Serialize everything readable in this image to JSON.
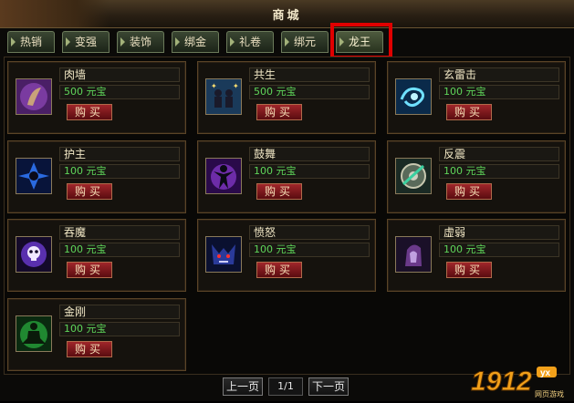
{
  "header": {
    "title": "商城"
  },
  "tabs": [
    {
      "label": "热销"
    },
    {
      "label": "变强"
    },
    {
      "label": "装饰"
    },
    {
      "label": "绑金"
    },
    {
      "label": "礼卷"
    },
    {
      "label": "绑元"
    },
    {
      "label": "龙王",
      "active": true
    }
  ],
  "items": [
    {
      "name": "肉墙",
      "price": "500 元宝",
      "buy": "购买",
      "icon": "tusk-icon",
      "color": "#7a3ba0"
    },
    {
      "name": "共生",
      "price": "500 元宝",
      "buy": "购买",
      "icon": "twin-figures-icon",
      "color": "#2b5a8a"
    },
    {
      "name": "玄雷击",
      "price": "100 元宝",
      "buy": "购买",
      "icon": "lightning-swirl-icon",
      "color": "#1e8ab8"
    },
    {
      "name": "护主",
      "price": "100 元宝",
      "buy": "购买",
      "icon": "shield-burst-icon",
      "color": "#1a4fa0"
    },
    {
      "name": "鼓舞",
      "price": "100 元宝",
      "buy": "购买",
      "icon": "figure-glow-icon",
      "color": "#6a2c9a"
    },
    {
      "name": "反震",
      "price": "100 元宝",
      "buy": "购买",
      "icon": "round-shield-icon",
      "color": "#3a6a4a"
    },
    {
      "name": "吞魔",
      "price": "100 元宝",
      "buy": "购买",
      "icon": "skull-orb-icon",
      "color": "#5a3aa0"
    },
    {
      "name": "愤怒",
      "price": "100 元宝",
      "buy": "购买",
      "icon": "demon-face-icon",
      "color": "#2a3a8a"
    },
    {
      "name": "虚弱",
      "price": "100 元宝",
      "buy": "购买",
      "icon": "ghost-hand-icon",
      "color": "#6a3a8a"
    },
    {
      "name": "金刚",
      "price": "100 元宝",
      "buy": "购买",
      "icon": "meditating-figure-icon",
      "color": "#2a8a3a"
    }
  ],
  "pager": {
    "prev": "上一页",
    "page": "1/1",
    "next": "下一页"
  },
  "watermark": {
    "text": "1912",
    "badge": "yx",
    "sub": "网页游戏"
  }
}
